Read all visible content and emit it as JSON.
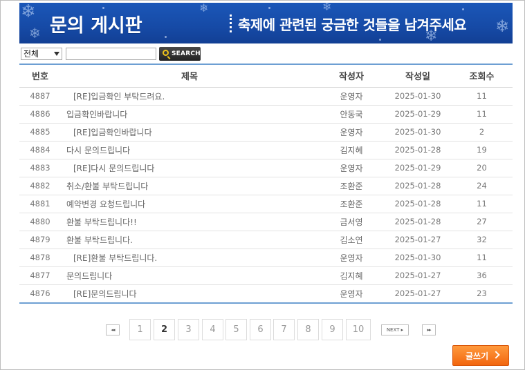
{
  "banner": {
    "title": "문의 게시판",
    "subtitle": "축제에 관련된 궁금한 것들을 남겨주세요"
  },
  "search": {
    "field_selected": "전체",
    "query_value": "",
    "button_label": "SEARCH"
  },
  "table": {
    "headers": {
      "no": "번호",
      "subject": "제목",
      "writer": "작성자",
      "date": "작성일",
      "views": "조회수"
    },
    "rows": [
      {
        "no": "4887",
        "subject": "[RE]입금확인 부탁드려요.",
        "reply": true,
        "writer": "운영자",
        "date": "2025-01-30",
        "views": "11"
      },
      {
        "no": "4886",
        "subject": "입금확인바랍니다",
        "reply": false,
        "writer": "안동국",
        "date": "2025-01-29",
        "views": "11"
      },
      {
        "no": "4885",
        "subject": "[RE]입금확인바랍니다",
        "reply": true,
        "writer": "운영자",
        "date": "2025-01-30",
        "views": "2"
      },
      {
        "no": "4884",
        "subject": "다시 문의드립니다",
        "reply": false,
        "writer": "김지혜",
        "date": "2025-01-28",
        "views": "19"
      },
      {
        "no": "4883",
        "subject": "[RE]다시 문의드립니다",
        "reply": true,
        "writer": "운영자",
        "date": "2025-01-29",
        "views": "20"
      },
      {
        "no": "4882",
        "subject": "취소/환불 부탁드립니다",
        "reply": false,
        "writer": "조환준",
        "date": "2025-01-28",
        "views": "24"
      },
      {
        "no": "4881",
        "subject": "예약변경 요청드립니다",
        "reply": false,
        "writer": "조환준",
        "date": "2025-01-28",
        "views": "11"
      },
      {
        "no": "4880",
        "subject": "환불 부탁드립니다!!",
        "reply": false,
        "writer": "금서영",
        "date": "2025-01-28",
        "views": "27"
      },
      {
        "no": "4879",
        "subject": "환불 부탁드립니다.",
        "reply": false,
        "writer": "김소연",
        "date": "2025-01-27",
        "views": "32"
      },
      {
        "no": "4878",
        "subject": "[RE]환불 부탁드립니다.",
        "reply": true,
        "writer": "운영자",
        "date": "2025-01-30",
        "views": "11"
      },
      {
        "no": "4877",
        "subject": "문의드립니다",
        "reply": false,
        "writer": "김지혜",
        "date": "2025-01-27",
        "views": "36"
      },
      {
        "no": "4876",
        "subject": "[RE]문의드립니다",
        "reply": true,
        "writer": "운영자",
        "date": "2025-01-27",
        "views": "23"
      }
    ]
  },
  "pagination": {
    "first_label": "◂◂",
    "pages": [
      "1",
      "2",
      "3",
      "4",
      "5",
      "6",
      "7",
      "8",
      "9",
      "10"
    ],
    "current": "2",
    "next_label": "NEXT ▸",
    "last_label": "▸▸"
  },
  "actions": {
    "write_label": "글쓰기"
  }
}
